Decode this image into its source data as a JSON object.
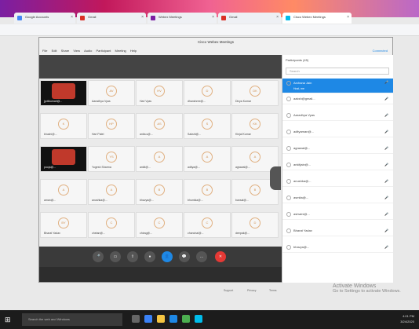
{
  "browser": {
    "tabs": [
      {
        "label": "Google Accounts",
        "color": "#4285f4"
      },
      {
        "label": "Gmail",
        "color": "#d93025"
      },
      {
        "label": "Webex Meetings",
        "color": "#7b1fa2"
      },
      {
        "label": "Gmail",
        "color": "#d93025"
      },
      {
        "label": "Cisco Webex Meetings",
        "color": "#00bceb"
      }
    ]
  },
  "window": {
    "title": "Cisco Webex Meetings",
    "menu": [
      "File",
      "Edit",
      "Share",
      "View",
      "Audio",
      "Participant",
      "Meeting",
      "Help"
    ],
    "connected": "Connected"
  },
  "tiles": [
    {
      "initials": "",
      "name": "jyotikumari@...",
      "video": true
    },
    {
      "initials": "AV",
      "name": "Aaradhya Vyas",
      "video": false
    },
    {
      "initials": "HV",
      "name": "Hari Vyas",
      "video": false
    },
    {
      "initials": "D",
      "name": "dhanshree@...",
      "video": false
    },
    {
      "initials": "DK",
      "name": "Divya Kumar",
      "video": false
    },
    {
      "initials": "K",
      "name": "khushi@...",
      "video": false
    },
    {
      "initials": "HP",
      "name": "Hari Patel",
      "video": false
    },
    {
      "initials": "AS",
      "name": "anita.s@...",
      "video": false
    },
    {
      "initials": "S",
      "name": "Sakshi@...",
      "video": false
    },
    {
      "initials": "KK",
      "name": "Kinjal Kumar",
      "video": false
    },
    {
      "initials": "",
      "name": "pooja@...",
      "video": true
    },
    {
      "initials": "YS",
      "name": "Yogesh Sharma",
      "video": false
    },
    {
      "initials": "A",
      "name": "ankit@...",
      "video": false
    },
    {
      "initials": "A",
      "name": "aditya@...",
      "video": false
    },
    {
      "initials": "A",
      "name": "agrawal@...",
      "video": false
    },
    {
      "initials": "A",
      "name": "aman@...",
      "video": false
    },
    {
      "initials": "A",
      "name": "anushka@...",
      "video": false
    },
    {
      "initials": "B",
      "name": "bhavya@...",
      "video": false
    },
    {
      "initials": "B",
      "name": "bhumika@...",
      "video": false
    },
    {
      "initials": "B",
      "name": "bansal@...",
      "video": false
    },
    {
      "initials": "BY",
      "name": "Bharat Yadav",
      "video": false
    },
    {
      "initials": "C",
      "name": "chetan@...",
      "video": false
    },
    {
      "initials": "C",
      "name": "chirag@...",
      "video": false
    },
    {
      "initials": "C",
      "name": "chanchal@...",
      "video": false
    },
    {
      "initials": "D",
      "name": "deepak@...",
      "video": false
    }
  ],
  "panel": {
    "title": "Participants (45)",
    "search_placeholder": "Search",
    "participants": [
      {
        "name": "Archana Jain",
        "sub": "Host, me",
        "selected": true
      },
      {
        "name": "aaksh@gmail...",
        "selected": false
      },
      {
        "name": "Aaradhya Vyas",
        "selected": false
      },
      {
        "name": "adityaman@...",
        "selected": false
      },
      {
        "name": "agrawal@...",
        "selected": false
      },
      {
        "name": "ankitjain@...",
        "selected": false
      },
      {
        "name": "anushka@...",
        "selected": false
      },
      {
        "name": "asmita@...",
        "selected": false
      },
      {
        "name": "ashwini@...",
        "selected": false
      },
      {
        "name": "Bharat Yadav",
        "selected": false
      },
      {
        "name": "bhavya@...",
        "selected": false
      }
    ]
  },
  "footer": {
    "links": [
      "Support",
      "Privacy",
      "Terms"
    ]
  },
  "watermark": {
    "line1": "Activate Windows",
    "line2": "Go to Settings to activate Windows."
  },
  "taskbar": {
    "search_placeholder": "Search the web and Windows",
    "time": "4:01 PM",
    "date": "3/24/2020"
  }
}
